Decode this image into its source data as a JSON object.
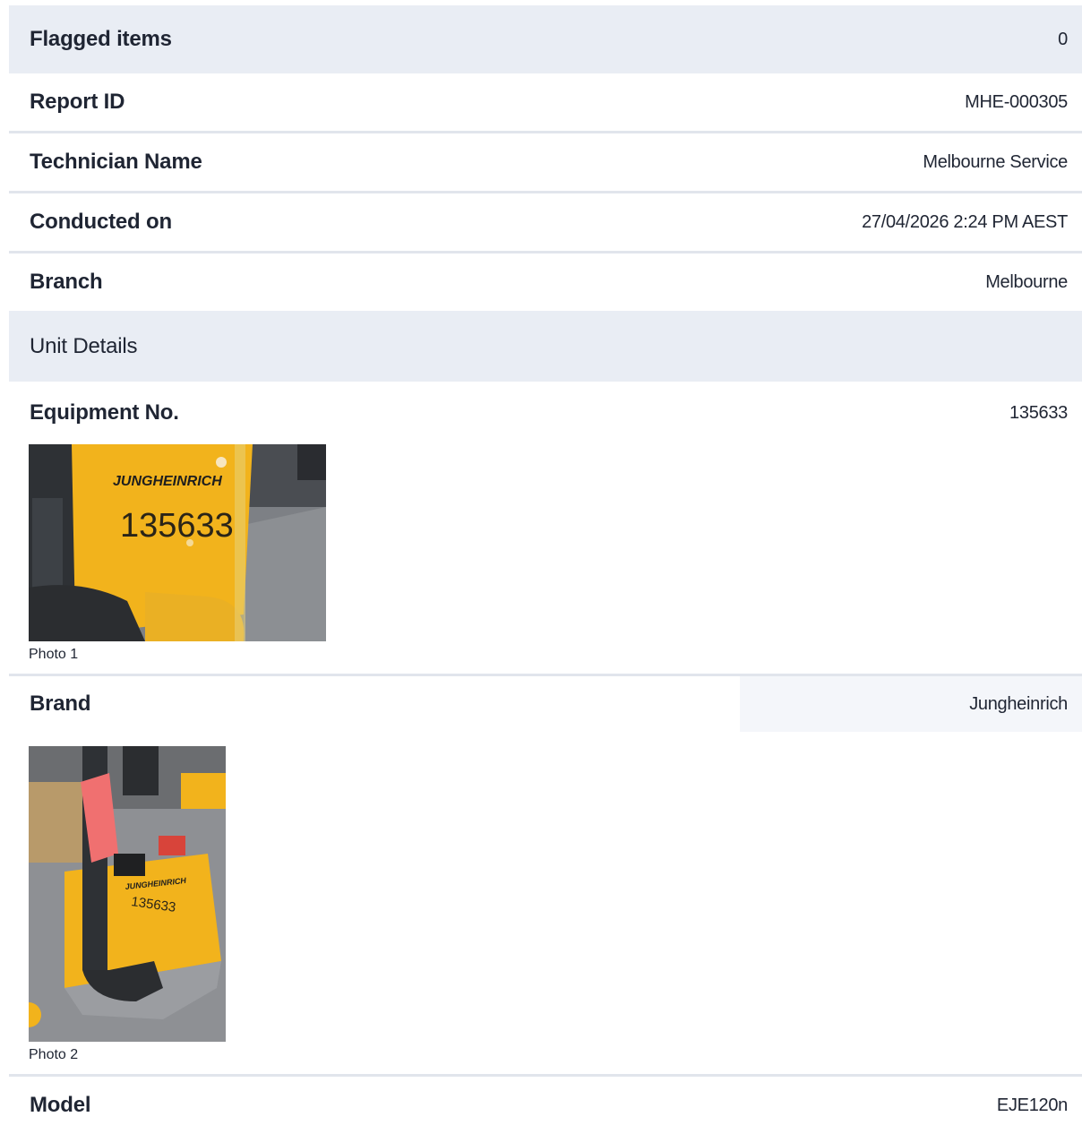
{
  "summary": {
    "flagged_label": "Flagged items",
    "flagged_value": "0",
    "report_id_label": "Report ID",
    "report_id_value": "MHE-000305",
    "technician_label": "Technician Name",
    "technician_value": "Melbourne Service",
    "conducted_label": "Conducted on",
    "conducted_value": "27/04/2026 2:24 PM AEST",
    "branch_label": "Branch",
    "branch_value": "Melbourne"
  },
  "section": {
    "title": "Unit Details"
  },
  "unit": {
    "equipment_label": "Equipment No.",
    "equipment_value": "135633",
    "photo1_caption": "Photo 1",
    "photo1_brand_text": "JUNGHEINRICH",
    "photo1_number_text": "135633",
    "brand_label": "Brand",
    "brand_value": "Jungheinrich",
    "photo2_caption": "Photo 2",
    "photo2_brand_text": "JUNGHEINRICH",
    "photo2_number_text": "135633",
    "model_label": "Model",
    "model_value": "EJE120n"
  },
  "colors": {
    "header_bg": "#e9edf4",
    "divider": "#e1e5ec",
    "machine_yellow": "#f2b31c",
    "text": "#1f2533"
  }
}
